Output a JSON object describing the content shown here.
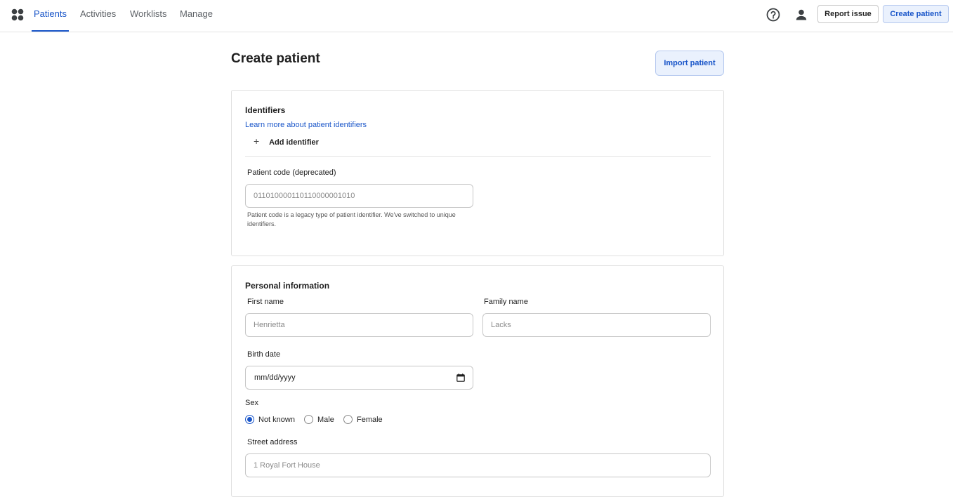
{
  "nav": {
    "tabs": [
      {
        "label": "Patients",
        "active": true
      },
      {
        "label": "Activities",
        "active": false
      },
      {
        "label": "Worklists",
        "active": false
      },
      {
        "label": "Manage",
        "active": false
      }
    ],
    "report_issue": "Report issue",
    "create_patient": "Create patient",
    "icons": [
      "apps-grid-icon",
      "help-icon",
      "account-icon"
    ]
  },
  "page": {
    "title": "Create patient",
    "import_button": "Import patient"
  },
  "identifiers": {
    "title": "Identifiers",
    "learn_more": "Learn more about patient identifiers",
    "add_identifier": "Add identifier",
    "patient_code_label": "Patient code (deprecated)",
    "patient_code_placeholder": "011010000110110000001010",
    "patient_code_help": "Patient code is a legacy type of patient identifier. We've switched to unique identifiers."
  },
  "personal": {
    "title": "Personal information",
    "first_name_label": "First name",
    "first_name_placeholder": "Henrietta",
    "family_name_label": "Family name",
    "family_name_placeholder": "Lacks",
    "birth_date_label": "Birth date",
    "birth_date_value": "mm/dd/yyyy",
    "sex_label": "Sex",
    "sex_options": [
      {
        "label": "Not known",
        "checked": true
      },
      {
        "label": "Male",
        "checked": false
      },
      {
        "label": "Female",
        "checked": false
      }
    ],
    "street_label": "Street address",
    "street_placeholder": "1 Royal Fort House"
  },
  "colors": {
    "accent": "#1a56c9",
    "accent_bg": "#eaf1fd",
    "border": "#e0e0e0"
  }
}
